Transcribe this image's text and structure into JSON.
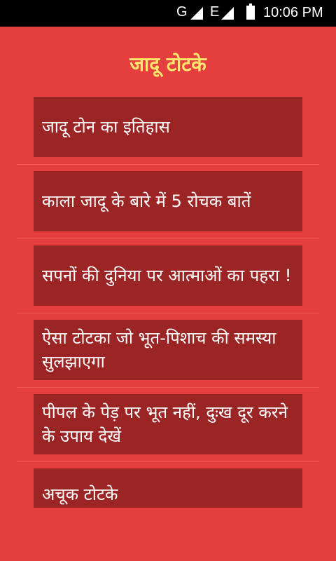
{
  "status_bar": {
    "network_g": "G",
    "network_e": "E",
    "time": "10:06 PM",
    "icons": [
      "signal-icon",
      "signal-icon",
      "battery-icon"
    ]
  },
  "app": {
    "title": "जादू टोटके"
  },
  "items": [
    {
      "label": "जादू टोन का इतिहास"
    },
    {
      "label": "काला जादू के बारे में 5 रोचक बातें"
    },
    {
      "label": "सपनों की दुनिया पर आत्माओं का पहरा !"
    },
    {
      "label": "ऐसा टोटका जो भूत-पिशाच की समस्या सुलझाएगा"
    },
    {
      "label": "पीपल के पेड़ पर भूत नहीं, दुःख दूर करने के उपाय देखें"
    },
    {
      "label": "अचूक टोटके"
    }
  ]
}
